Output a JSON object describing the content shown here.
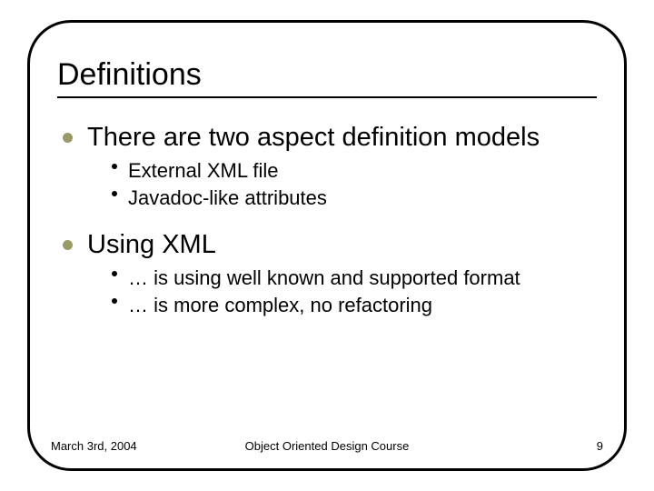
{
  "title": "Definitions",
  "items": [
    {
      "text": "There are two aspect definition models",
      "sub": [
        "External XML file",
        "Javadoc-like attributes"
      ]
    },
    {
      "text": "Using XML",
      "sub": [
        "… is using well known and supported format",
        "… is more complex, no refactoring"
      ]
    }
  ],
  "footer": {
    "date": "March 3rd, 2004",
    "course": "Object Oriented Design Course",
    "page": "9"
  }
}
